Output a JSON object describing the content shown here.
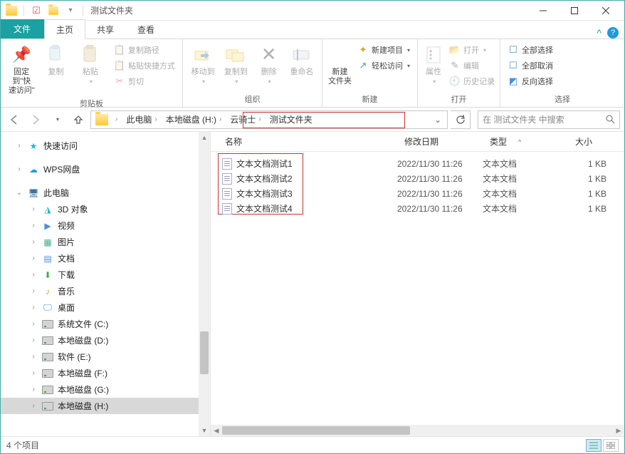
{
  "window": {
    "title": "测试文件夹"
  },
  "tabs": {
    "file": "文件",
    "home": "主页",
    "share": "共享",
    "view": "查看"
  },
  "ribbon": {
    "clipboard": {
      "label": "剪贴板",
      "pin": "固定到\"快\n速访问\"",
      "copy": "复制",
      "paste": "粘贴",
      "copy_path": "复制路径",
      "paste_shortcut": "粘贴快捷方式",
      "cut": "剪切"
    },
    "organize": {
      "label": "组织",
      "move_to": "移动到",
      "copy_to": "复制到",
      "delete": "删除",
      "rename": "重命名"
    },
    "new": {
      "label": "新建",
      "new_folder": "新建\n文件夹",
      "new_item": "新建项目",
      "easy_access": "轻松访问"
    },
    "open": {
      "label": "打开",
      "properties": "属性",
      "open": "打开",
      "edit": "编辑",
      "history": "历史记录"
    },
    "select": {
      "label": "选择",
      "select_all": "全部选择",
      "select_none": "全部取消",
      "invert": "反向选择"
    }
  },
  "breadcrumb": {
    "root": "此电脑",
    "parts": [
      "本地磁盘 (H:)",
      "云骑士",
      "测试文件夹"
    ]
  },
  "search": {
    "placeholder": "在 测试文件夹 中搜索"
  },
  "columns": {
    "name": "名称",
    "date": "修改日期",
    "type": "类型",
    "size": "大小"
  },
  "tree": {
    "quick_access": "快速访问",
    "wps": "WPS网盘",
    "this_pc": "此电脑",
    "items": [
      {
        "label": "3D 对象",
        "icon": "cube"
      },
      {
        "label": "视频",
        "icon": "video"
      },
      {
        "label": "图片",
        "icon": "image"
      },
      {
        "label": "文档",
        "icon": "doc"
      },
      {
        "label": "下载",
        "icon": "download"
      },
      {
        "label": "音乐",
        "icon": "music"
      },
      {
        "label": "桌面",
        "icon": "desktop"
      },
      {
        "label": "系统文件 (C:)",
        "icon": "drive"
      },
      {
        "label": "本地磁盘 (D:)",
        "icon": "drive"
      },
      {
        "label": "软件 (E:)",
        "icon": "drive"
      },
      {
        "label": "本地磁盘 (F:)",
        "icon": "drive"
      },
      {
        "label": "本地磁盘 (G:)",
        "icon": "drive"
      },
      {
        "label": "本地磁盘 (H:)",
        "icon": "drive",
        "selected": true
      }
    ]
  },
  "files": [
    {
      "name": "文本文档测试1",
      "date": "2022/11/30 11:26",
      "type": "文本文档",
      "size": "1 KB"
    },
    {
      "name": "文本文档测试2",
      "date": "2022/11/30 11:26",
      "type": "文本文档",
      "size": "1 KB"
    },
    {
      "name": "文本文档测试3",
      "date": "2022/11/30 11:26",
      "type": "文本文档",
      "size": "1 KB"
    },
    {
      "name": "文本文档测试4",
      "date": "2022/11/30 11:26",
      "type": "文本文档",
      "size": "1 KB"
    }
  ],
  "status": {
    "count": "4 个项目"
  }
}
